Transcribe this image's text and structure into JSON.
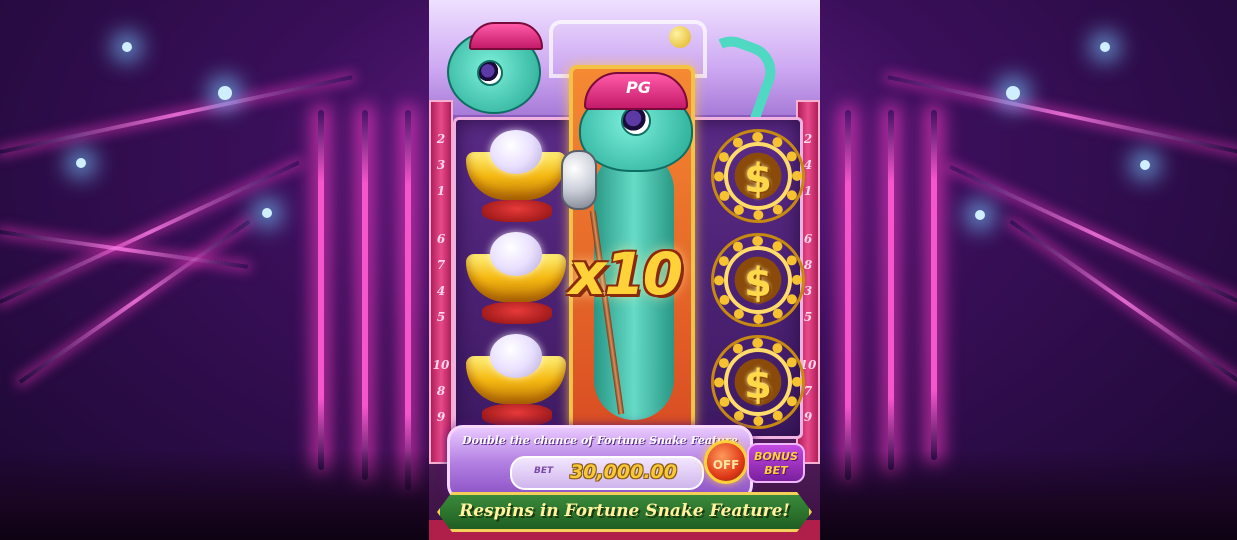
{
  "left_pillar_numbers": [
    "2",
    "3",
    "1",
    "6",
    "7",
    "4",
    "5",
    "10",
    "8",
    "9"
  ],
  "right_pillar_numbers": [
    "2",
    "4",
    "1",
    "6",
    "8",
    "3",
    "5",
    "10",
    "7",
    "9"
  ],
  "multiplier_text": "x10",
  "cap_logo": "PG",
  "coin_symbol": "$",
  "bonus_bet_panel": {
    "description": "Double the chance of Fortune Snake Feature",
    "bet_label": "BET",
    "bet_value": "30,000.00",
    "toggle_label": "OFF",
    "bonus_button_label_line1": "BONUS",
    "bonus_button_label_line2": "BET"
  },
  "banner_text": "Respins in Fortune Snake Feature!",
  "colors": {
    "background": "#3a0f5a",
    "neon_pink": "#ff5ad2",
    "gold": "#f6c232",
    "banner_green": "#2f7a32",
    "snake_teal": "#4fd8c2"
  },
  "icons": [
    "gold-ingot-icon",
    "dollar-coin-chain-icon",
    "snake-mascot-icon",
    "microphone-icon"
  ]
}
